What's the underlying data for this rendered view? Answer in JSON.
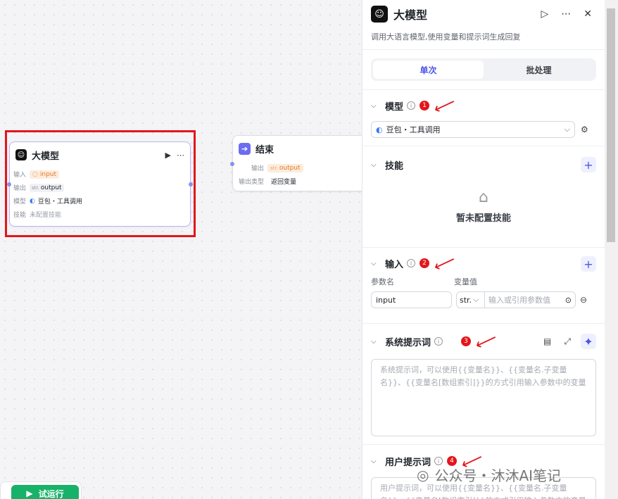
{
  "llm_node": {
    "title": "大模型",
    "rows": [
      {
        "label": "输入",
        "value": "input"
      },
      {
        "label": "输出",
        "type": "str.",
        "value": "output"
      },
      {
        "label": "模型",
        "value": "豆包・工具调用"
      },
      {
        "label": "技能",
        "value": "未配置技能"
      }
    ]
  },
  "end_node": {
    "title": "结束",
    "out_label": "输出",
    "out_type": "str.",
    "out_value": "output",
    "type_label": "输出类型",
    "type_value": "返回变量"
  },
  "run_button": "试运行",
  "panel": {
    "title": "大模型",
    "description": "调用大语言模型,使用变量和提示词生成回复",
    "tabs": [
      "单次",
      "批处理"
    ],
    "model": {
      "title": "模型",
      "badge": "1",
      "selected": "豆包・工具调用"
    },
    "skills": {
      "title": "技能",
      "empty": "暂未配置技能"
    },
    "inputs": {
      "title": "输入",
      "badge": "2",
      "col_name": "参数名",
      "col_value": "变量值",
      "param_name": "input",
      "type": "str.",
      "value_placeholder": "输入或引用参数值"
    },
    "system_prompt": {
      "title": "系统提示词",
      "badge": "3",
      "placeholder": "系统提示词，可以使用{{变量名}}、{{变量名.子变量名}}、{{变量名[数组索引]}}的方式引用输入参数中的变量"
    },
    "user_prompt": {
      "title": "用户提示词",
      "badge": "4",
      "placeholder": "用户提示词，可以使用{{变量名}}、{{变量名.子变量名}}、{{变量名[数组索引]}}的方式引用输入参数中的变量"
    }
  },
  "watermark": "公众号・沐沐AI笔记",
  "colors": {
    "accent": "#4d53e8",
    "annotation_red": "#e3161b",
    "run_green": "#17b26a"
  }
}
